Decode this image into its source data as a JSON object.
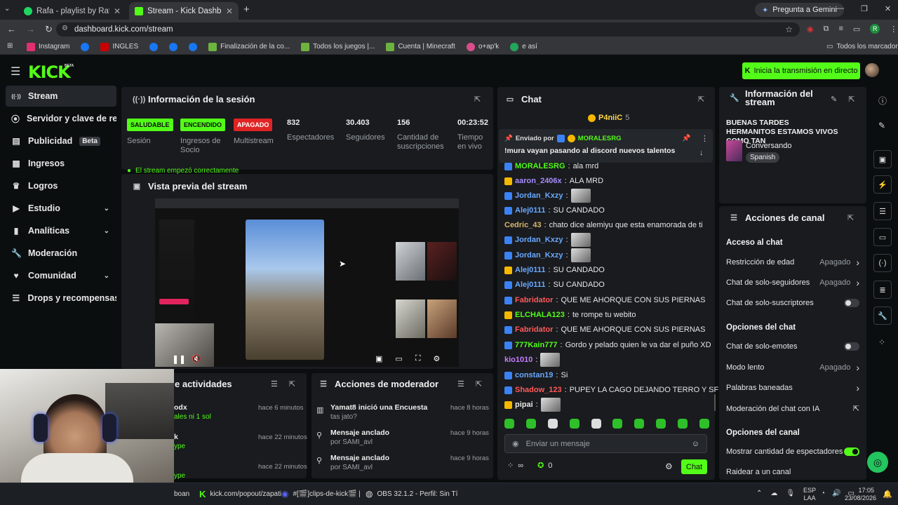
{
  "browser": {
    "tabs": [
      {
        "title": "Rafa - playlist by Rafael.xared |",
        "active": false
      },
      {
        "title": "Stream - Kick Dashboard",
        "active": true
      }
    ],
    "url": "dashboard.kick.com/stream",
    "gemini_button": "Pregunta a Gemini",
    "bookmarks": [
      "Instagram",
      "INGLES",
      "Finalización de la co...",
      "Todos los juegos |...",
      "Cuenta | Minecraft",
      "o+ap'k",
      "e así"
    ],
    "all_bookmarks": "Todos los marcadores"
  },
  "header": {
    "logo": "KICK",
    "logo_beta": "BETA",
    "go_live_button": "Inicia la transmisión en directo"
  },
  "sidebar": {
    "items": [
      {
        "label": "Stream",
        "icon": "broadcast-icon",
        "active": true,
        "beta": false,
        "chev": false
      },
      {
        "label": "Servidor y clave de retran",
        "icon": "link-icon",
        "active": false,
        "beta": false,
        "chev": false
      },
      {
        "label": "Publicidad",
        "icon": "ad-icon",
        "active": false,
        "beta": true,
        "chev": false
      },
      {
        "label": "Ingresos",
        "icon": "revenue-icon",
        "active": false,
        "beta": false,
        "chev": false
      },
      {
        "label": "Logros",
        "icon": "trophy-icon",
        "active": false,
        "beta": false,
        "chev": false
      },
      {
        "label": "Estudio",
        "icon": "studio-icon",
        "active": false,
        "beta": false,
        "chev": true
      },
      {
        "label": "Analíticas",
        "icon": "analytics-icon",
        "active": false,
        "beta": false,
        "chev": true
      },
      {
        "label": "Moderación",
        "icon": "wrench-icon",
        "active": false,
        "beta": false,
        "chev": false
      },
      {
        "label": "Comunidad",
        "icon": "community-icon",
        "active": false,
        "beta": false,
        "chev": true
      },
      {
        "label": "Drops y recompensas",
        "icon": "drops-icon",
        "active": false,
        "beta": false,
        "chev": false
      }
    ],
    "beta_label": "Beta"
  },
  "session": {
    "title": "Información de la sesión",
    "health_badge": "SALUDABLE",
    "health_label": "Sesión",
    "socio_badge": "ENCENDIDO",
    "socio_label": "Ingresos de Socio",
    "multistream_badge": "APAGADO",
    "multistream_label": "Multistream",
    "viewers_value": "832",
    "viewers_label": "Espectadores",
    "followers_value": "30.403",
    "followers_label": "Seguidores",
    "subs_value": "156",
    "subs_label": "Cantidad de suscripciones",
    "uptime_value": "00:23:52",
    "uptime_label": "Tiempo en vivo",
    "notice": "El stream empezó correctamente"
  },
  "preview": {
    "title": "Vista previa del stream"
  },
  "activity": {
    "title": "e actividades",
    "items": [
      {
        "user": "odx",
        "sub": "ales ni 1 sol",
        "time": "hace 6 minutos"
      },
      {
        "user": "k",
        "sub": "ype",
        "time": "hace 22 minutos"
      },
      {
        "user": "",
        "sub": "ype",
        "time": "hace 22 minutos"
      }
    ]
  },
  "modactions": {
    "title": "Acciones de moderador",
    "items": [
      {
        "line1": "Yamat8 inició una Encuesta",
        "line2": "tas jato?",
        "time": "hace 8 horas",
        "icon": "poll-icon"
      },
      {
        "line1": "Mensaje anclado",
        "line2": "por SAMI_avl",
        "time": "hace 9 horas",
        "icon": "pin-icon"
      },
      {
        "line1": "Mensaje anclado",
        "line2": "por SAMI_avl",
        "time": "hace 9 horas",
        "icon": "pin-icon"
      }
    ]
  },
  "chat": {
    "title": "Chat",
    "top_user": "P4niiC",
    "top_count": "5",
    "pinned_by": "Enviado por",
    "pinned_user": "MORALESRG",
    "pinned_text": "!mura vayan pasando al discord nuevos talentos",
    "messages": [
      {
        "user": "MORALESRG",
        "text": "ala mrd",
        "color": "#53fc18"
      },
      {
        "user": "aaron_2406x",
        "text": "ALA MRD",
        "color": "#a78bfa"
      },
      {
        "user": "Jordan_Kxzy",
        "text": "",
        "color": "#6aa8ff",
        "emote": true
      },
      {
        "user": "Alej0111",
        "text": "SU CANDADO",
        "color": "#6aa8ff"
      },
      {
        "user": "Cedric_43",
        "text": "chato dice alemiyu que esta enamorada de ti",
        "color": "#d8b66a"
      },
      {
        "user": "Jordan_Kxzy",
        "text": "",
        "color": "#6aa8ff",
        "emote": true
      },
      {
        "user": "Jordan_Kxzy",
        "text": "",
        "color": "#6aa8ff",
        "emote": true
      },
      {
        "user": "Alej0111",
        "text": "SU CANDADO",
        "color": "#6aa8ff"
      },
      {
        "user": "Alej0111",
        "text": "SU CANDADO",
        "color": "#6aa8ff"
      },
      {
        "user": "Fabridator",
        "text": "QUE ME AHORQUE CON SUS PIERNAS",
        "color": "#ff5a5a"
      },
      {
        "user": "ELCHALA123",
        "text": "te rompe tu webito",
        "color": "#53fc18"
      },
      {
        "user": "Fabridator",
        "text": "QUE ME AHORQUE CON SUS PIERNAS",
        "color": "#ff5a5a"
      },
      {
        "user": "777Kain777",
        "text": "Gordo y pelado quien le va dar el puño XD",
        "color": "#53fc18"
      },
      {
        "user": "kio1010",
        "text": "",
        "color": "#c77dff",
        "emote": true
      },
      {
        "user": "constan19",
        "text": "Si",
        "color": "#6aa8ff"
      },
      {
        "user": "Shadow_123",
        "text": "PUPEY LA CAGO DEJANDO TERRO Y SF",
        "color": "#ff5a5a"
      },
      {
        "user": "pipai",
        "text": "",
        "color": "#e8e8e8",
        "emote": true
      }
    ],
    "input_placeholder": "Enviar un mensaje",
    "points": "∞",
    "count": "0",
    "send_button": "Chat"
  },
  "stream_info": {
    "title": "Información del stream",
    "stream_title": "BUENAS TARDES HERMANITOS ESTAMOS VIVOS COMO TAN",
    "category": "Conversando",
    "language": "Spanish"
  },
  "channel_actions": {
    "title": "Acciones de canal",
    "chat_access": "Acceso al chat",
    "rows1": [
      {
        "label": "Restricción de edad",
        "value": "Apagado",
        "kind": "chev"
      },
      {
        "label": "Chat de solo-seguidores",
        "value": "Apagado",
        "kind": "chev"
      },
      {
        "label": "Chat de solo-suscriptores",
        "value": "",
        "kind": "toggle-off"
      }
    ],
    "chat_options": "Opciones del chat",
    "rows2": [
      {
        "label": "Chat de solo-emotes",
        "value": "",
        "kind": "toggle-off"
      },
      {
        "label": "Modo lento",
        "value": "Apagado",
        "kind": "chev"
      },
      {
        "label": "Palabras baneadas",
        "value": "",
        "kind": "chev"
      },
      {
        "label": "Moderación del chat con IA",
        "value": "",
        "kind": "ext"
      }
    ],
    "channel_options": "Opciones del canal",
    "rows3": [
      {
        "label": "Mostrar cantidad de espectadores",
        "value": "",
        "kind": "toggle-on"
      },
      {
        "label": "Raidear a un canal",
        "value": "",
        "kind": ""
      }
    ]
  },
  "taskbar": {
    "items": [
      "kick.com/popout/zapati",
      "#[🎬]clips-de-kick🎬 |",
      "OBS 32.1.2 - Perfil: Sin Tí"
    ],
    "partial": "boan",
    "lang": "ESP",
    "lang2": "LAA",
    "time": "17:05",
    "date": "23/08/2026"
  },
  "colors": {
    "accent": "#53fc18",
    "panel": "#191b1f",
    "bg": "#0b0e0f",
    "danger": "#e02424"
  }
}
